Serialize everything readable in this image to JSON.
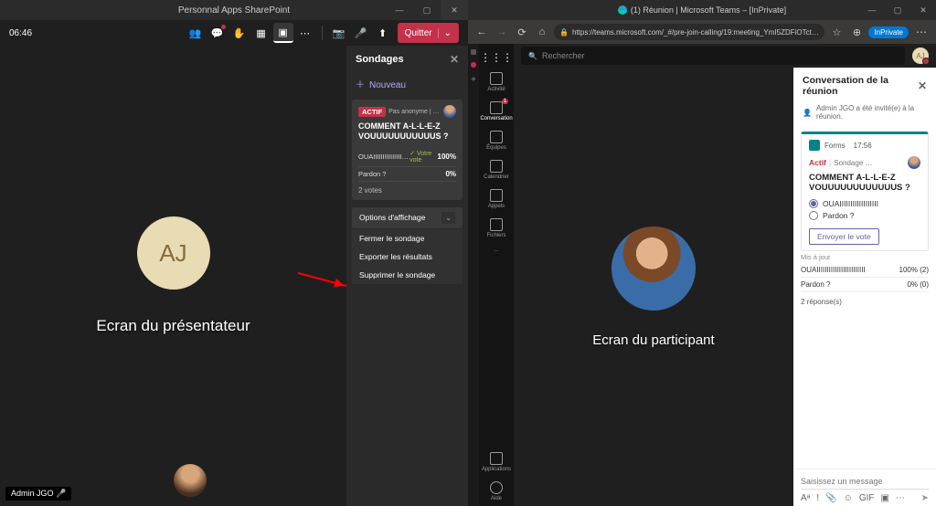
{
  "presenter": {
    "titlebar": "Personnal Apps SharePoint",
    "timer": "06:46",
    "quit_label": "Quitter",
    "avatar_initials": "AJ",
    "stage_caption": "Ecran du présentateur",
    "badge_name": "Admin JGO  🎤",
    "poll": {
      "header": "Sondages",
      "new_label": "Nouveau",
      "active_tag": "ACTIF",
      "subtitle": "Pas anonyme | Résultats par…",
      "question": "COMMENT A-L-L-E-Z VOUUUUUUUUUUUS ?",
      "opt1_label": "OUAIIIIIIIIIIIIIIIIIIIIIIIIII",
      "opt1_vote_indicator": "Votre vote",
      "opt1_pct": "100%",
      "opt2_label": "Pardon ?",
      "opt2_pct": "0%",
      "votes": "2 votes",
      "options_btn": "Options d'affichage",
      "menu": {
        "close": "Fermer le sondage",
        "export": "Exporter les résultats",
        "delete": "Supprimer le sondage"
      }
    }
  },
  "participant": {
    "browser_title": "(1) Réunion | Microsoft Teams – [InPrivate]",
    "url": "https://teams.microsoft.com/_#/pre-join-calling/19:meeting_YmI5ZDFiOTctY…",
    "inprivate": "InPrivate",
    "search_placeholder": "Rechercher",
    "avatar_initials": "AJ",
    "rail": {
      "activity": "Activité",
      "chat": "Conversation",
      "chat_badge": "1",
      "teams": "Équipes",
      "calendar": "Calendrier",
      "calls": "Appels",
      "files": "Fichiers",
      "more": "…",
      "apps": "Applications",
      "help": "Aide"
    },
    "stage_caption": "Ecran du participant",
    "chat": {
      "header": "Conversation de la réunion",
      "system": "Admin JGO a été invité(e) à la réunion.",
      "forms_label": "Forms",
      "forms_time": "17:56",
      "active": "Actif",
      "poll_sub": "Sondage …",
      "question": "COMMENT A-L-L-E-Z VOUUUUUUUUUUUUS ?",
      "opt1": "OUAIIIIIIIIIIIIIIIIII",
      "opt2": "Pardon ?",
      "send_vote": "Envoyer le vote",
      "update_section": "Mis à jour",
      "res1_label": "OUAIIIIIIIIIIIIIIIIIIIIIIII",
      "res1_pct": "100% (2)",
      "res2_label": "Pardon ?",
      "res2_pct": "0% (0)",
      "responses": "2 réponse(s)",
      "compose_placeholder": "Saisissez un message"
    }
  }
}
